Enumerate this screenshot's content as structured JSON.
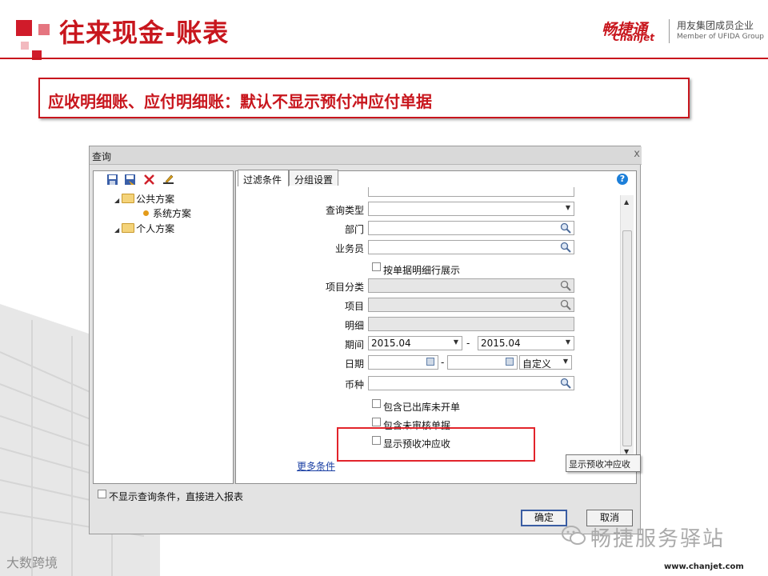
{
  "header": {
    "title": "往来现金-账表",
    "logo_cn": "畅捷通",
    "logo_en": "Chanjet",
    "logo_tag_cn": "用友集团成员企业",
    "logo_tag_en": "Member of UFIDA Group"
  },
  "banner": {
    "text": "应收明细账、应付明细账：默认不显示预付冲应付单据"
  },
  "dialog": {
    "title": "查询",
    "close": "x",
    "toolbar_icons": [
      "save-icon",
      "save-as-icon",
      "delete-icon",
      "edit-icon"
    ],
    "tree": {
      "public_schemes": "公共方案",
      "system_scheme": "系统方案",
      "personal_schemes": "个人方案"
    },
    "tabs": [
      "过滤条件",
      "分组设置"
    ],
    "help": "?",
    "filters": {
      "query_type_label": "查询类型",
      "dept_label": "部门",
      "salesman_label": "业务员",
      "by_doc_detail": "按单据明细行展示",
      "item_category_label": "项目分类",
      "item_label": "项目",
      "detail_label": "明细",
      "period_label": "期间",
      "period_from": "2015.04",
      "period_to": "2015.04",
      "range_sep": "-",
      "date_label": "日期",
      "date_mode": "自定义",
      "currency_label": "币种",
      "incl_outbound_uninvoiced": "包含已出库未开单",
      "incl_unaudited": "包含未审核单据",
      "show_prepay_offset": "显示预收冲应收"
    },
    "more_conditions": "更多条件",
    "tooltip": "显示预收冲应收",
    "no_show_query": "不显示查询条件，直接进入报表",
    "ok": "确定",
    "cancel": "取消"
  },
  "footer": {
    "watermark_left": "大数跨境",
    "wechat_name": "畅捷服务驿站",
    "url": "www.chanjet.com"
  }
}
